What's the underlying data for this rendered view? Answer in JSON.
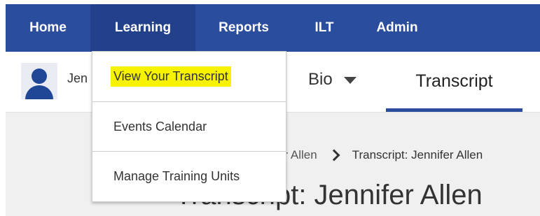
{
  "nav": {
    "home": "Home",
    "learning": "Learning",
    "reports": "Reports",
    "ilt": "ILT",
    "admin": "Admin"
  },
  "profile": {
    "name_fragment": "Jen",
    "bio_tab": "Bio",
    "transcript_tab": "Transcript"
  },
  "dropdown": {
    "items": [
      {
        "label": "View Your Transcript",
        "highlighted": true
      },
      {
        "label": "Events Calendar"
      },
      {
        "label": "Manage Training Units"
      }
    ]
  },
  "breadcrumb": {
    "link_fragment": "er Allen",
    "current": "Transcript: Jennifer Allen"
  },
  "page": {
    "title_fragment": "Transcript: Jennifer Allen"
  },
  "colors": {
    "nav_bg": "#2b4d9e",
    "nav_active_bg": "#23418a",
    "highlight": "#f7f200",
    "tab_underline": "#2b4d9e"
  }
}
